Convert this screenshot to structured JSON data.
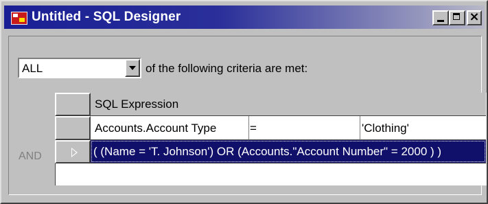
{
  "window": {
    "title": "Untitled - SQL Designer",
    "icon": "sql-designer-app-icon",
    "controls": {
      "minimize": "minimize-icon",
      "maximize": "maximize-icon",
      "close_glyph": "×"
    }
  },
  "criteria": {
    "match_selected": "ALL",
    "trailing_text": "of the following criteria are met:"
  },
  "grid": {
    "column_header": "SQL Expression",
    "rows": [
      {
        "conjunction": "",
        "field": "Accounts.Account Type",
        "operator": "=",
        "value": "'Clothing'"
      },
      {
        "conjunction": "AND",
        "expression": "( (Name = 'T. Johnson')  OR  (Accounts.\"Account Number\" = 2000 ) )",
        "selected": true
      }
    ]
  },
  "colors": {
    "title_gradient_start": "#1a1f94",
    "selection": "#10106b",
    "face": "#c0c0c0"
  }
}
